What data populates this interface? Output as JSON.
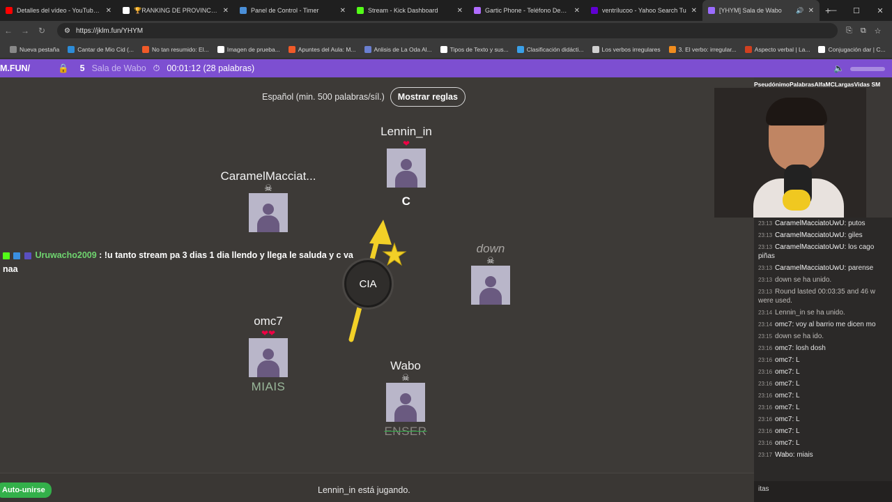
{
  "browser": {
    "tabs": [
      {
        "title": "Detalles del vídeo - YouTube St",
        "color": "#ff0000"
      },
      {
        "title": "🏆RANKING DE PROVINCIAS a",
        "color": "#ffffff"
      },
      {
        "title": "Panel de Control - Timer",
        "color": "#4a8fd8"
      },
      {
        "title": "Stream - Kick Dashboard",
        "color": "#53fc18"
      },
      {
        "title": "Gartic Phone - Teléfono Desco",
        "color": "#b06cff"
      },
      {
        "title": "ventrílucoo - Yahoo Search Tu",
        "color": "#6001d2"
      },
      {
        "title": "[YHYM] Sala de Wabo",
        "color": "#9b6cff"
      }
    ],
    "url": "https://jklm.fun/YHYM",
    "bookmarks": [
      {
        "label": "Nueva pestaña",
        "color": "#888888"
      },
      {
        "label": "Cantar de Mio Cid (...",
        "color": "#2d8cd8"
      },
      {
        "label": "No tan resumido: El...",
        "color": "#f05a28"
      },
      {
        "label": "Imagen de prueba...",
        "color": "#ffffff"
      },
      {
        "label": "Apuntes del Aula: M...",
        "color": "#f05a28"
      },
      {
        "label": "Anlisis de La Oda Al...",
        "color": "#6a7fd0"
      },
      {
        "label": "Tipos de Texto y sus...",
        "color": "#ffffff"
      },
      {
        "label": "Clasificación didácti...",
        "color": "#3aa0e8"
      },
      {
        "label": "Los verbos irregulares",
        "color": "#d0d0d0"
      },
      {
        "label": "3. El verbo: irregular...",
        "color": "#f08c1e"
      },
      {
        "label": "Aspecto verbal | La...",
        "color": "#d04020"
      },
      {
        "label": "Conjugación dar | C...",
        "color": "#ffffff"
      }
    ]
  },
  "game_header": {
    "brand": "M.FUN/",
    "player_count": "5",
    "room": "Sala de Wabo",
    "timer": "00:01:12 (28 palabras)"
  },
  "rules": {
    "language": "Español (min. 500 palabras/síl.)",
    "button": "Mostrar reglas"
  },
  "players": {
    "lennin": {
      "name": "Lennin_in",
      "status": "❤",
      "word": "C"
    },
    "caramel": {
      "name": "CaramelMacciat...",
      "status": "☠",
      "word": ""
    },
    "down": {
      "name": "down",
      "status": "☠",
      "word": ""
    },
    "omc7": {
      "name": "omc7",
      "status": "❤❤",
      "word": "MIAIS"
    },
    "wabo": {
      "name": "Wabo",
      "status": "☠",
      "word": "ENSER"
    }
  },
  "bomb": {
    "syllable": "CIA"
  },
  "overlay_chat": {
    "user": "Uruwacho2009",
    "text": ": !u tanto stream pa 3 dias 1 dia llendo y llega le saluda y c va naa"
  },
  "bottom": {
    "auto_join": "Auto-unirse",
    "status": "Lennin_in está jugando."
  },
  "stream_top": "PseudónimoPalabrasAlfaMCLargasVidas SM",
  "chat": [
    {
      "time": "23:13",
      "name": "CaramelMacciatoUwU:",
      "text": "putos"
    },
    {
      "time": "23:13",
      "name": "CaramelMacciatoUwU:",
      "text": "giles"
    },
    {
      "time": "23:13",
      "name": "CaramelMacciatoUwU:",
      "text": "los cago piñas"
    },
    {
      "time": "23:13",
      "name": "CaramelMacciatoUwU:",
      "text": "parense"
    },
    {
      "time": "23:13",
      "name": "",
      "text": "down se ha unido."
    },
    {
      "time": "23:13",
      "name": "",
      "text": "Round lasted 00:03:35 and 46 w were used."
    },
    {
      "time": "23:14",
      "name": "",
      "text": "Lennin_in se ha unido."
    },
    {
      "time": "23:14",
      "name": "omc7:",
      "text": "voy al barrio me dicen mo"
    },
    {
      "time": "23:15",
      "name": "",
      "text": "down se ha ido."
    },
    {
      "time": "23:16",
      "name": "omc7:",
      "text": "losh dosh"
    },
    {
      "time": "23:16",
      "name": "omc7:",
      "text": "L"
    },
    {
      "time": "23:16",
      "name": "omc7:",
      "text": "L"
    },
    {
      "time": "23:16",
      "name": "omc7:",
      "text": "L"
    },
    {
      "time": "23:16",
      "name": "omc7:",
      "text": "L"
    },
    {
      "time": "23:16",
      "name": "omc7:",
      "text": "L"
    },
    {
      "time": "23:16",
      "name": "omc7:",
      "text": "L"
    },
    {
      "time": "23:16",
      "name": "omc7:",
      "text": "L"
    },
    {
      "time": "23:16",
      "name": "omc7:",
      "text": "L"
    },
    {
      "time": "23:17",
      "name": "Wabo:",
      "text": "miais"
    }
  ],
  "chat_input": "itas",
  "colors": {
    "accent": "#7d4fd1",
    "alive": "#e0245e",
    "success": "#33b04a"
  }
}
